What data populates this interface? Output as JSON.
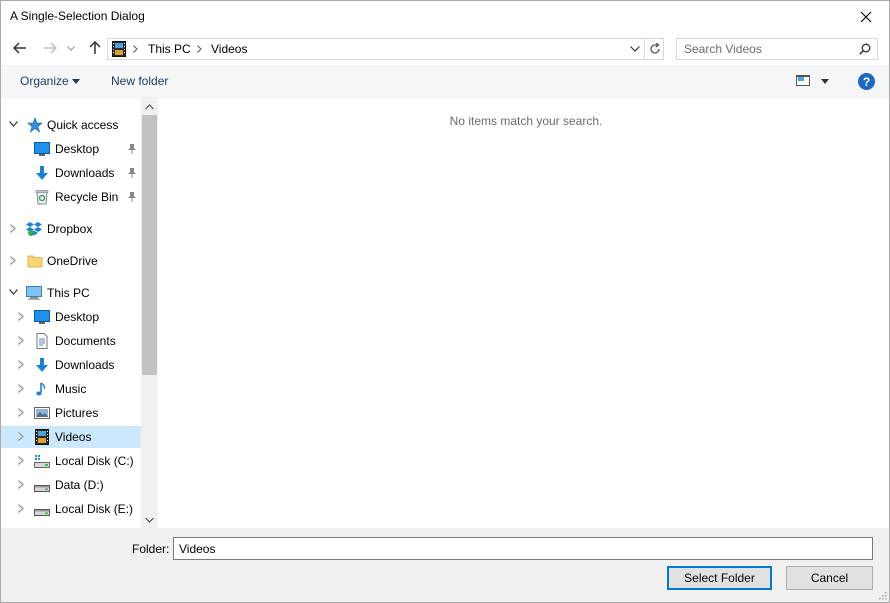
{
  "window": {
    "title": "A Single-Selection Dialog"
  },
  "address": {
    "breadcrumbs": [
      "This PC",
      "Videos"
    ]
  },
  "search": {
    "placeholder": "Search Videos"
  },
  "toolbar": {
    "organize_label": "Organize",
    "new_folder_label": "New folder",
    "help_label": "?"
  },
  "sidebar": {
    "items": [
      {
        "label": "Quick access",
        "icon": "star-icon",
        "level": 0,
        "expanded": true,
        "pinned": false
      },
      {
        "label": "Desktop",
        "icon": "desktop-icon",
        "level": 1,
        "pinned": true
      },
      {
        "label": "Downloads",
        "icon": "download-icon",
        "level": 1,
        "pinned": true
      },
      {
        "label": "Recycle Bin",
        "icon": "recycle-bin-icon",
        "level": 1,
        "pinned": true
      },
      {
        "label": "Dropbox",
        "icon": "dropbox-icon",
        "level": 0,
        "expanded": false
      },
      {
        "label": "OneDrive",
        "icon": "folder-icon",
        "level": 0,
        "expanded": false
      },
      {
        "label": "This PC",
        "icon": "computer-icon",
        "level": 0,
        "expanded": true
      },
      {
        "label": "Desktop",
        "icon": "desktop-icon",
        "level": 1
      },
      {
        "label": "Documents",
        "icon": "documents-icon",
        "level": 1
      },
      {
        "label": "Downloads",
        "icon": "download-icon",
        "level": 1
      },
      {
        "label": "Music",
        "icon": "music-icon",
        "level": 1
      },
      {
        "label": "Pictures",
        "icon": "pictures-icon",
        "level": 1
      },
      {
        "label": "Videos",
        "icon": "video-icon",
        "level": 1,
        "selected": true
      },
      {
        "label": "Local Disk (C:)",
        "icon": "system-drive-icon",
        "level": 1
      },
      {
        "label": "Data (D:)",
        "icon": "drive-icon",
        "level": 1
      },
      {
        "label": "Local Disk (E:)",
        "icon": "drive-icon",
        "level": 1
      }
    ]
  },
  "content": {
    "empty_message": "No items match your search."
  },
  "footer": {
    "folder_label": "Folder:",
    "folder_value": "Videos",
    "select_button": "Select Folder",
    "cancel_button": "Cancel"
  },
  "colors": {
    "selection": "#cce8ff",
    "accent": "#0078d7",
    "help": "#1c68c2",
    "toolbar_bg": "#f5f6f7",
    "footer_bg": "#f0f0f0"
  }
}
